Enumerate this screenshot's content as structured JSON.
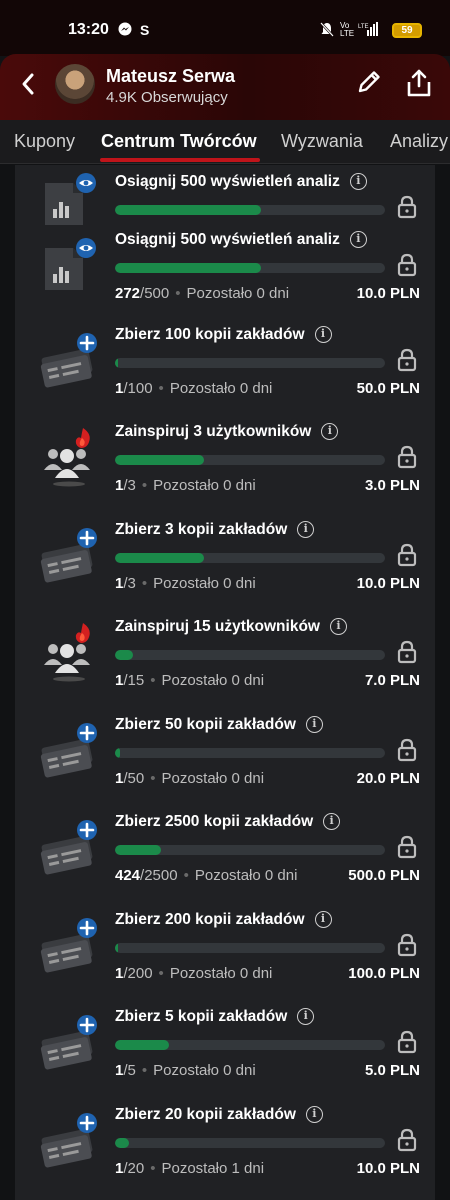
{
  "status_bar": {
    "time": "13:20",
    "battery": "59"
  },
  "header": {
    "profile_name": "Mateusz Serwa",
    "followers": "4.9K Obserwujący"
  },
  "tabs": [
    "Kupony",
    "Centrum Twórców",
    "Wyzwania",
    "Analizy"
  ],
  "active_tab": "Centrum Twórców",
  "colors": {
    "progress_fill": "#1b8a4a",
    "tab_underline": "#c0141a",
    "badge_blue": "#1f63b0",
    "badge_red": "#d32020"
  },
  "challenges": [
    {
      "icon": "analysis-views-icon",
      "title": "Osiągnij 500 wyświetleń analiz",
      "progress": 0.54,
      "meta": null
    },
    {
      "icon": "analysis-views-icon",
      "title": "Osiągnij 500 wyświetleń analiz",
      "progress": 0.54,
      "current": "272",
      "target": "/500",
      "remaining": "Pozostało 0 dni",
      "reward": "10.0 PLN"
    },
    {
      "icon": "bet-slip-add-icon",
      "title": "Zbierz 100 kopii zakładów",
      "progress": 0.01,
      "current": "1",
      "target": "/100",
      "remaining": "Pozostało 0 dni",
      "reward": "50.0 PLN"
    },
    {
      "icon": "inspire-users-icon",
      "title": "Zainspiruj 3 użytkowników",
      "progress": 0.33,
      "current": "1",
      "target": "/3",
      "remaining": "Pozostało 0 dni",
      "reward": "3.0 PLN"
    },
    {
      "icon": "bet-slip-add-icon",
      "title": "Zbierz 3 kopii zakładów",
      "progress": 0.33,
      "current": "1",
      "target": "/3",
      "remaining": "Pozostało 0 dni",
      "reward": "10.0 PLN"
    },
    {
      "icon": "inspire-users-icon",
      "title": "Zainspiruj 15 użytkowników",
      "progress": 0.066,
      "current": "1",
      "target": "/15",
      "remaining": "Pozostało 0 dni",
      "reward": "7.0 PLN"
    },
    {
      "icon": "bet-slip-add-icon",
      "title": "Zbierz 50 kopii zakładów",
      "progress": 0.02,
      "current": "1",
      "target": "/50",
      "remaining": "Pozostało 0 dni",
      "reward": "20.0 PLN"
    },
    {
      "icon": "bet-slip-add-icon",
      "title": "Zbierz 2500 kopii zakładów",
      "progress": 0.17,
      "current": "424",
      "target": "/2500",
      "remaining": "Pozostało 0 dni",
      "reward": "500.0 PLN"
    },
    {
      "icon": "bet-slip-add-icon",
      "title": "Zbierz 200 kopii zakładów",
      "progress": 0.005,
      "current": "1",
      "target": "/200",
      "remaining": "Pozostało 0 dni",
      "reward": "100.0 PLN"
    },
    {
      "icon": "bet-slip-add-icon",
      "title": "Zbierz 5 kopii zakładów",
      "progress": 0.2,
      "current": "1",
      "target": "/5",
      "remaining": "Pozostało 0 dni",
      "reward": "5.0 PLN"
    },
    {
      "icon": "bet-slip-add-icon",
      "title": "Zbierz 20 kopii zakładów",
      "progress": 0.05,
      "current": "1",
      "target": "/20",
      "remaining": "Pozostało 1 dni",
      "reward": "10.0 PLN"
    }
  ]
}
